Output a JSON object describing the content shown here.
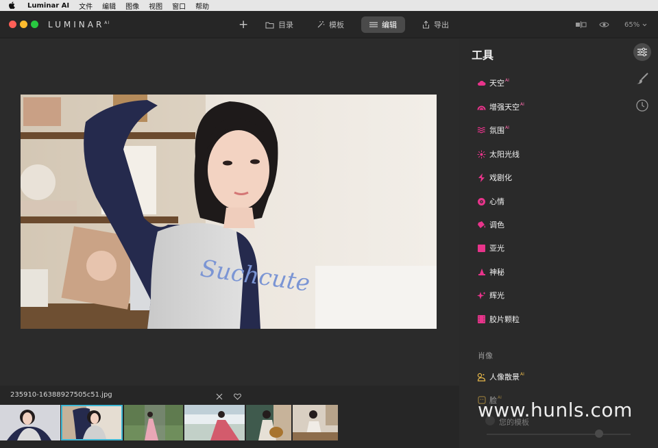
{
  "menubar": {
    "app_name": "Luminar AI",
    "items": [
      "文件",
      "编辑",
      "图像",
      "视图",
      "窗口",
      "帮助"
    ]
  },
  "titlebar": {
    "brand": "LUMINAR",
    "brand_suffix": "AI",
    "nav": {
      "add": "+",
      "catalog": "目录",
      "templates": "模板",
      "edit": "编辑",
      "export": "导出"
    },
    "zoom": "65%"
  },
  "filmstrip": {
    "filename": "235910-16388927505c51.jpg"
  },
  "sidebar": {
    "title": "工具",
    "tools": [
      {
        "label": "天空",
        "ai": "AI",
        "icon": "cloud-icon"
      },
      {
        "label": "增强天空",
        "ai": "AI",
        "icon": "sky-enhance-icon"
      },
      {
        "label": "氛围",
        "ai": "AI",
        "icon": "atmosphere-icon"
      },
      {
        "label": "太阳光线",
        "ai": "",
        "icon": "sunrays-icon"
      },
      {
        "label": "戏剧化",
        "ai": "",
        "icon": "drama-icon"
      },
      {
        "label": "心情",
        "ai": "",
        "icon": "mood-icon"
      },
      {
        "label": "调色",
        "ai": "",
        "icon": "toning-icon"
      },
      {
        "label": "亚光",
        "ai": "",
        "icon": "matte-icon"
      },
      {
        "label": "神秘",
        "ai": "",
        "icon": "mystical-icon"
      },
      {
        "label": "辉光",
        "ai": "",
        "icon": "glow-icon"
      },
      {
        "label": "胶片颗粒",
        "ai": "",
        "icon": "film-grain-icon"
      }
    ],
    "section": "肖像",
    "portrait_tools": [
      {
        "label": "人像散景",
        "ai": "AI",
        "icon": "bokeh-icon"
      },
      {
        "label": "脸",
        "ai": "AI",
        "icon": "face-icon"
      }
    ],
    "templates_label": "您的模板"
  },
  "watermark": "www.hunls.com",
  "colors": {
    "accent_pink": "#e8348b",
    "portrait_gold": "#e7b84a",
    "thumb_selected": "#3fb9d6"
  }
}
